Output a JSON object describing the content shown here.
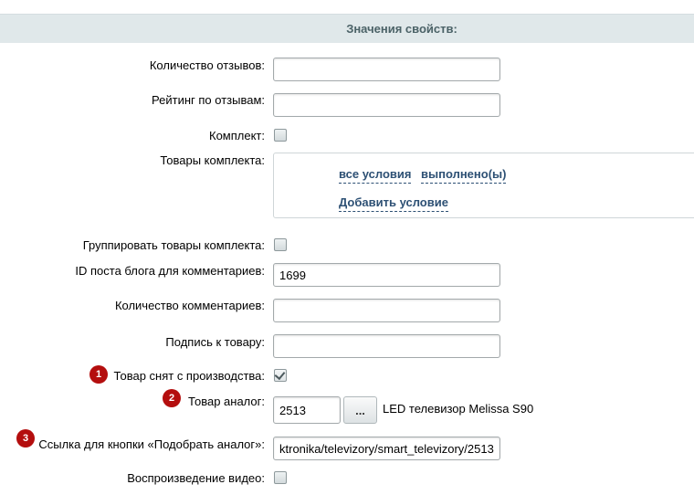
{
  "header": {
    "title": "Значения свойств:"
  },
  "fields": {
    "reviews_count": {
      "label": "Количество отзывов:",
      "value": ""
    },
    "reviews_rating": {
      "label": "Рейтинг по отзывам:",
      "value": ""
    },
    "bundle": {
      "label": "Комплект:",
      "checked": false
    },
    "bundle_products": {
      "label": "Товары комплекта:",
      "all_conditions": "все условия",
      "fulfilled": "выполнено(ы)",
      "add_condition": "Добавить условие"
    },
    "group_bundle": {
      "label": "Группировать товары комплекта:",
      "checked": false
    },
    "blog_post_id": {
      "label": "ID поста блога для комментариев:",
      "value": "1699"
    },
    "comments_count": {
      "label": "Количество комментариев:",
      "value": ""
    },
    "product_caption": {
      "label": "Подпись к товару:",
      "value": ""
    },
    "discontinued": {
      "label": "Товар снят с производства:",
      "checked": true,
      "badge": "1"
    },
    "analog": {
      "label": "Товар аналог:",
      "value": "2513",
      "browse_label": "...",
      "product_name": "LED телевизор Melissa S90",
      "badge": "2"
    },
    "analog_link": {
      "label": "Ссылка для кнопки «Подобрать аналог»:",
      "value": "ktronika/televizory/smart_televizory/2513/",
      "badge": "3"
    },
    "video": {
      "label": "Воспроизведение видео:",
      "checked": false
    }
  },
  "colors": {
    "badge": "#b40e0e",
    "header_bg": "#e0e8ea",
    "link": "#2d5074"
  }
}
